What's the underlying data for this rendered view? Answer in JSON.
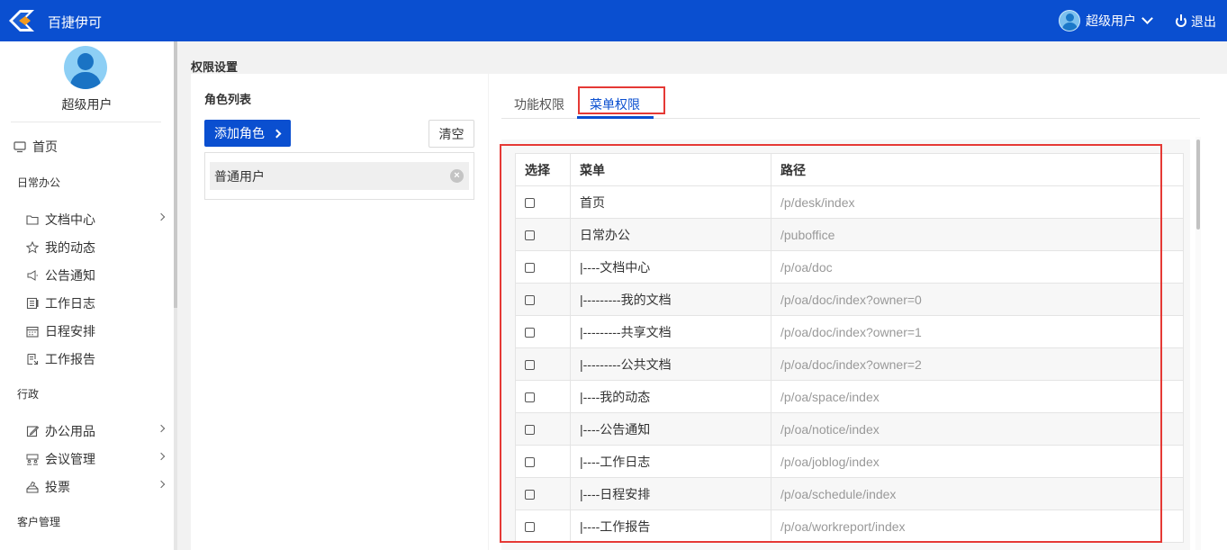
{
  "header": {
    "brand": "百捷伊可",
    "user_name": "超级用户",
    "logout_label": "退出",
    "bg_color": "#0a4fd0"
  },
  "sidebar": {
    "user_name": "超级用户",
    "home": {
      "label": "首页",
      "icon": "monitor-icon"
    },
    "sections": [
      {
        "title": "日常办公",
        "items": [
          {
            "label": "文档中心",
            "icon": "folder-icon",
            "has_children": true
          },
          {
            "label": "我的动态",
            "icon": "star-icon",
            "has_children": false
          },
          {
            "label": "公告通知",
            "icon": "megaphone-icon",
            "has_children": false
          },
          {
            "label": "工作日志",
            "icon": "journal-icon",
            "has_children": false
          },
          {
            "label": "日程安排",
            "icon": "calendar-icon",
            "has_children": false
          },
          {
            "label": "工作报告",
            "icon": "report-icon",
            "has_children": false
          }
        ]
      },
      {
        "title": "行政",
        "items": [
          {
            "label": "办公用品",
            "icon": "edit-icon",
            "has_children": true
          },
          {
            "label": "会议管理",
            "icon": "meeting-icon",
            "has_children": true
          },
          {
            "label": "投票",
            "icon": "vote-icon",
            "has_children": true
          }
        ]
      },
      {
        "title": "客户管理",
        "items": []
      }
    ]
  },
  "page": {
    "title": "权限设置"
  },
  "roles": {
    "heading": "角色列表",
    "add_label": "添加角色",
    "clear_label": "清空",
    "items": [
      "普通用户"
    ]
  },
  "tabs": [
    {
      "label": "功能权限",
      "active": false
    },
    {
      "label": "菜单权限",
      "active": true
    }
  ],
  "table": {
    "headers": [
      "选择",
      "菜单",
      "路径"
    ],
    "rows": [
      {
        "menu": "首页",
        "path": "/p/desk/index"
      },
      {
        "menu": "日常办公",
        "path": "/puboffice"
      },
      {
        "menu": "|----文档中心",
        "path": "/p/oa/doc"
      },
      {
        "menu": "|---------我的文档",
        "path": "/p/oa/doc/index?owner=0"
      },
      {
        "menu": "|---------共享文档",
        "path": "/p/oa/doc/index?owner=1"
      },
      {
        "menu": "|---------公共文档",
        "path": "/p/oa/doc/index?owner=2"
      },
      {
        "menu": "|----我的动态",
        "path": "/p/oa/space/index"
      },
      {
        "menu": "|----公告通知",
        "path": "/p/oa/notice/index"
      },
      {
        "menu": "|----工作日志",
        "path": "/p/oa/joblog/index"
      },
      {
        "menu": "|----日程安排",
        "path": "/p/oa/schedule/index"
      },
      {
        "menu": "|----工作报告",
        "path": "/p/oa/workreport/index"
      }
    ]
  },
  "colors": {
    "accent": "#0a4fd0",
    "highlight": "#e53935"
  }
}
